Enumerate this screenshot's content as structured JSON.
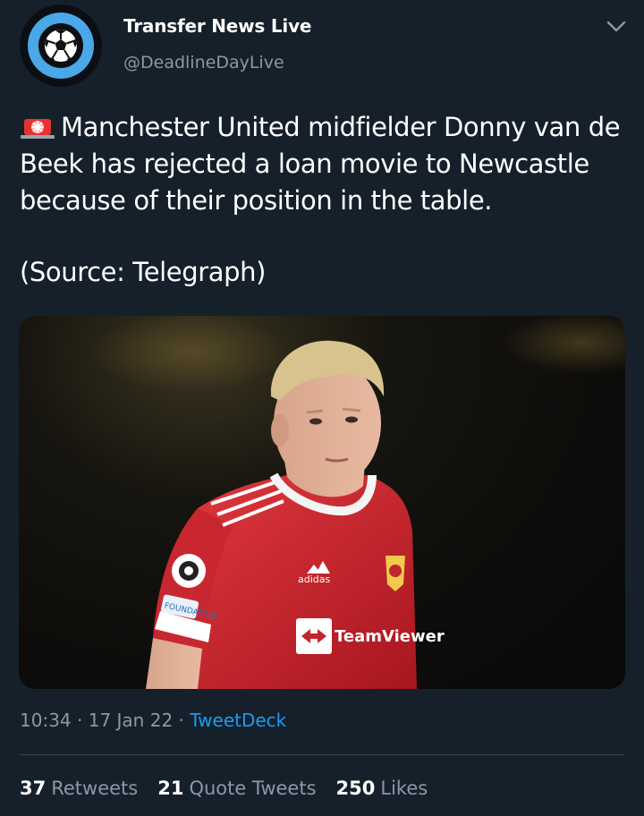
{
  "header": {
    "display_name": "Transfer News Live",
    "handle": "@DeadlineDayLive"
  },
  "tweet": {
    "siren_icon": "rotating-light-icon",
    "body": "Manchester United midfielder Donny van de\nBeek has rejected a loan movie to Newcastle\nbecause of their position in the table.",
    "source_line": "(Source: Telegraph)",
    "time": "10:34",
    "date": "17 Jan 22",
    "client": "TweetDeck"
  },
  "photo": {
    "shirt_sponsor_text": "TeamViewer",
    "kit_brand_text": "adidas",
    "sleeve_badge_text": "FOUNDATION"
  },
  "stats": {
    "retweets_count": "37",
    "retweets_label": "Retweets",
    "quote_count": "21",
    "quote_label": "Quote Tweets",
    "likes_count": "250",
    "likes_label": "Likes"
  },
  "colors": {
    "background": "#15202b",
    "accent": "#1d9bf0",
    "muted_text": "#8b98a5",
    "avatar_ring": "#4aa8e8",
    "shirt_red": "#d3242c"
  }
}
